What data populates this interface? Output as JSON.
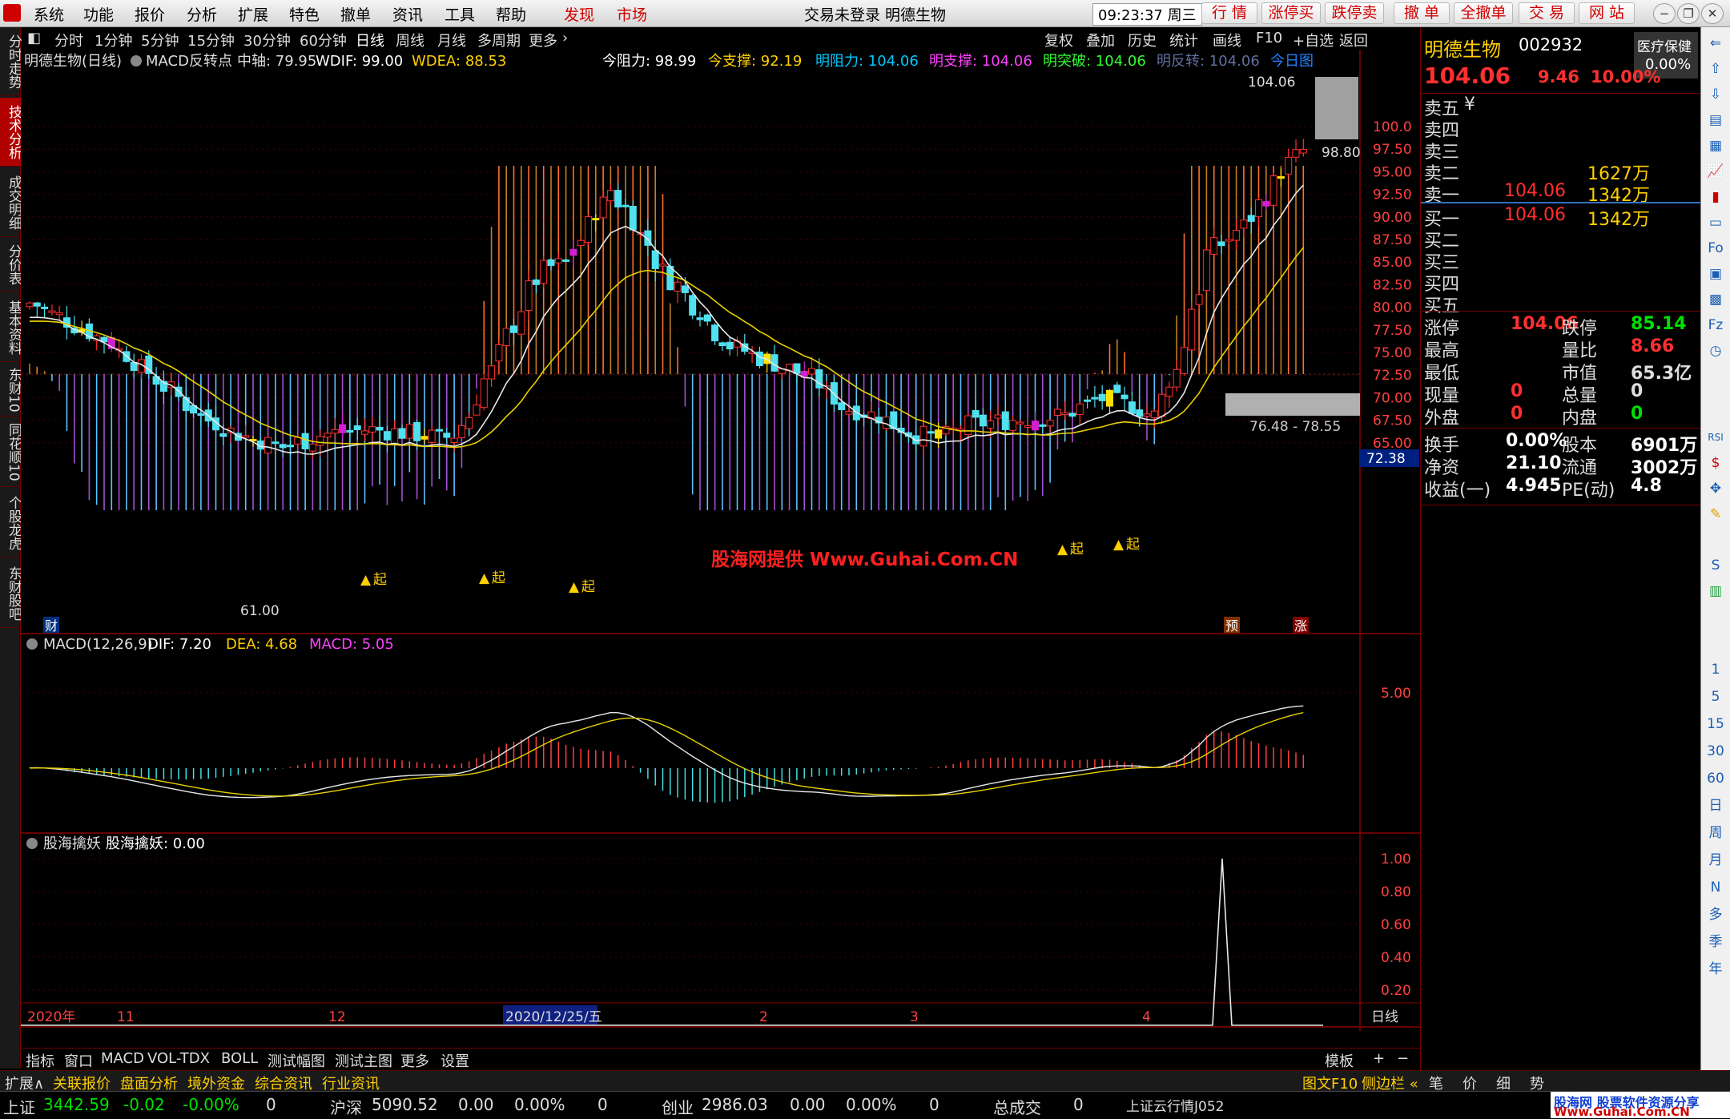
{
  "menu": {
    "items": [
      "系统",
      "功能",
      "报价",
      "分析",
      "扩展",
      "特色",
      "撤单",
      "资讯",
      "工具",
      "帮助",
      "发现",
      "市场"
    ],
    "title": "交易未登录  明德生物",
    "time": "09:23:37 周三",
    "quick": [
      "行 情",
      "涨停买",
      "跌停卖",
      "撤 单",
      "全撤单",
      "交 易",
      "网 站"
    ]
  },
  "left_tabs": [
    "分时走势",
    "技术分析",
    "成交明细",
    "分价表",
    "基本资料",
    "东财10",
    "同花顺10",
    "个股龙虎",
    "东财股吧"
  ],
  "periods": [
    "分时",
    "1分钟",
    "5分钟",
    "15分钟",
    "30分钟",
    "60分钟",
    "日线",
    "周线",
    "月线",
    "多周期",
    "更多"
  ],
  "top_tools": [
    "复权",
    "叠加",
    "历史",
    "统计",
    "画线",
    "F10",
    "+自选",
    "返回"
  ],
  "info": {
    "stock_name": "明德生物(日线)",
    "indicator": "MACD反转点",
    "zhongzhou": "中轴: 79.95",
    "wdif": "WDIF: 99.00",
    "wdea": "WDEA: 88.53",
    "jin_zuli": "今阻力: 98.99",
    "jin_zhicheng": "今支撑: 92.19",
    "ming_zuli": "明阻力: 104.06",
    "ming_zhicheng": "明支撑: 104.06",
    "ming_tupo": "明突破: 104.06",
    "ming_fanzhuan": "明反转: 104.06",
    "jinri_tu": "今日图"
  },
  "price_axis": [
    "100.0",
    "97.50",
    "95.00",
    "92.50",
    "90.00",
    "87.50",
    "85.00",
    "82.50",
    "80.00",
    "77.50",
    "75.00",
    "72.50",
    "70.00",
    "67.50",
    "65.00"
  ],
  "chart_labels": {
    "high_label": "104.06",
    "box_label": "98.80",
    "range_label": "76.48 - 78.55",
    "low_label": "61.00",
    "current_price_tag": "72.38",
    "qi": "起",
    "cai": "财",
    "yu": "预",
    "zhang": "涨",
    "watermark": "股海网提供 Www.Guhai.Com.CN"
  },
  "macd_panel": {
    "title": "MACD(12,26,9)",
    "dif": "DIF: 7.20",
    "dea": "DEA: 4.68",
    "macd": "MACD: 5.05",
    "axis": [
      "5.00"
    ]
  },
  "yao_panel": {
    "title": "股海擒妖",
    "value": "股海擒妖: 0.00",
    "axis": [
      "1.00",
      "0.80",
      "0.60",
      "0.40",
      "0.20"
    ]
  },
  "date_axis": [
    "2020年",
    "11",
    "12",
    "2020/12/25/五",
    "2",
    "3",
    "4",
    "日线"
  ],
  "tool_strip": [
    "指标",
    "窗口",
    "MACD",
    "VOL-TDX",
    "BOLL",
    "测试幅图",
    "测试主图",
    "更多",
    "设置",
    "模板",
    "+",
    "−"
  ],
  "status1": [
    "扩展∧",
    "关联报价",
    "盘面分析",
    "境外资金",
    "综合资讯",
    "行业资讯",
    "图文F10",
    "侧边栏 «",
    "笔",
    "价",
    "细",
    "势"
  ],
  "status2": {
    "sh_label": "上证",
    "sh_val": "3442.59",
    "sh_chg": "-0.02",
    "sh_pct": "-0.00%",
    "sh_vol": "0",
    "hs_label": "沪深",
    "hs_val": "5090.52",
    "hs_chg": "0.00",
    "hs_pct": "0.00%",
    "hs_vol": "0",
    "cy_label": "创业",
    "cy_val": "2986.03",
    "cy_chg": "0.00",
    "cy_pct": "0.00%",
    "cy_vol": "0",
    "total_label": "总成交",
    "total_val": "0",
    "cloud": "上证云行情J052",
    "brand": "股海网 股票软件资源分享",
    "brand_url": "Www.Guhai.Com.CN"
  },
  "quote": {
    "name": "明德生物",
    "code": "002932",
    "sector": "医疗保健",
    "sector_pct": "0.00%",
    "price": "104.06",
    "change": "9.46",
    "pct": "10.00%",
    "asks": [
      {
        "label": "卖五",
        "price": "",
        "vol": ""
      },
      {
        "label": "卖四",
        "price": "",
        "vol": ""
      },
      {
        "label": "卖三",
        "price": "",
        "vol": ""
      },
      {
        "label": "卖二",
        "price": "",
        "vol": "1627万"
      },
      {
        "label": "卖一",
        "price": "104.06",
        "vol": "1342万"
      }
    ],
    "bids": [
      {
        "label": "买一",
        "price": "104.06",
        "vol": "1342万"
      },
      {
        "label": "买二",
        "price": "",
        "vol": ""
      },
      {
        "label": "买三",
        "price": "",
        "vol": ""
      },
      {
        "label": "买四",
        "price": "",
        "vol": ""
      },
      {
        "label": "买五",
        "price": "",
        "vol": ""
      }
    ],
    "stats": [
      {
        "l1": "涨停",
        "v1": "104.06",
        "c1": "#ff3030",
        "l2": "跌停",
        "v2": "85.14",
        "c2": "#00e000"
      },
      {
        "l1": "最高",
        "v1": "",
        "c1": "#ff3030",
        "l2": "量比",
        "v2": "8.66",
        "c2": "#ff3030"
      },
      {
        "l1": "最低",
        "v1": "",
        "c1": "#ff3030",
        "l2": "市值",
        "v2": "65.3亿",
        "c2": "#dddddd"
      },
      {
        "l1": "现量",
        "v1": "0",
        "c1": "#ff3030",
        "l2": "总量",
        "v2": "0",
        "c2": "#dddddd"
      },
      {
        "l1": "外盘",
        "v1": "0",
        "c1": "#ff3030",
        "l2": "内盘",
        "v2": "0",
        "c2": "#00e000"
      }
    ],
    "stats2": [
      {
        "l1": "换手",
        "v1": "0.00%",
        "l2": "股本",
        "v2": "6901万"
      },
      {
        "l1": "净资",
        "v1": "21.10",
        "l2": "流通",
        "v2": "3002万"
      },
      {
        "l1": "收益(一)",
        "v1": "4.945",
        "l2": "PE(动)",
        "v2": "4.8"
      }
    ],
    "ask_sym": "¥"
  },
  "right_strip": [
    "1",
    "5",
    "15",
    "30",
    "60",
    "日",
    "周",
    "月",
    "N",
    "多",
    "季",
    "年"
  ]
}
